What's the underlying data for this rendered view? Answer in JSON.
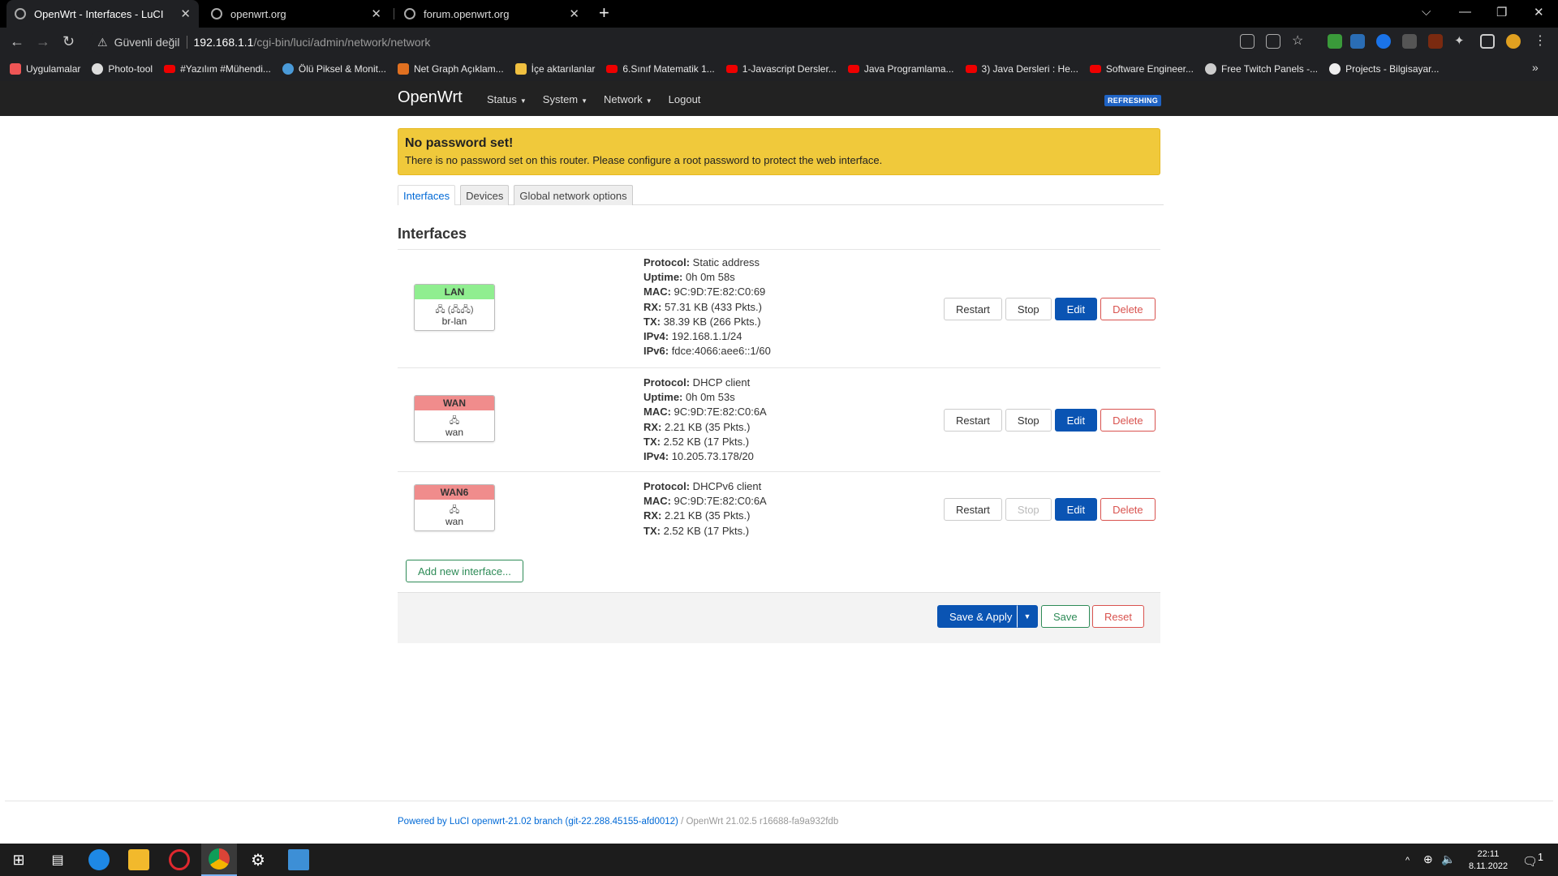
{
  "browser": {
    "tabs": [
      {
        "title": "OpenWrt - Interfaces - LuCI",
        "active": true
      },
      {
        "title": "openwrt.org",
        "active": false
      },
      {
        "title": "forum.openwrt.org",
        "active": false
      }
    ],
    "new_tab": "+",
    "security_label": "Güvenli değil",
    "url_host": "192.168.1.1",
    "url_path": "/cgi-bin/luci/admin/network/network",
    "bookmarks": [
      "Uygulamalar",
      "Photo-tool",
      "#Yazılım #Mühendi...",
      "Ölü Piksel & Monit...",
      "Net Graph Açıklam...",
      "İçe aktarılanlar",
      "6.Sınıf Matematik 1...",
      "1-Javascript Dersler...",
      "Java Programlama...",
      "3) Java Dersleri : He...",
      "Software Engineer...",
      "Free Twitch Panels -...",
      "Projects - Bilgisayar..."
    ],
    "bookmarks_more": "»"
  },
  "luci": {
    "brand": "OpenWrt",
    "menu": [
      "Status",
      "System",
      "Network",
      "Logout"
    ],
    "refresh_badge": "REFRESHING",
    "alert_title": "No password set!",
    "alert_text": "There is no password set on this router. Please configure a root password to protect the web interface.",
    "tabs": [
      "Interfaces",
      "Devices",
      "Global network options"
    ],
    "section_title": "Interfaces",
    "interfaces": [
      {
        "name": "LAN",
        "header_color": "#90ee90",
        "device": "br-lan",
        "icon_text": "🖧 (🖧🖧)",
        "details": [
          [
            "Protocol:",
            " Static address"
          ],
          [
            "Uptime:",
            " 0h 0m 58s"
          ],
          [
            "MAC:",
            " 9C:9D:7E:82:C0:69"
          ],
          [
            "RX:",
            " 57.31 KB (433 Pkts.)"
          ],
          [
            "TX:",
            " 38.39 KB (266 Pkts.)"
          ],
          [
            "IPv4:",
            " 192.168.1.1/24"
          ],
          [
            "IPv6:",
            " fdce:4066:aee6::1/60"
          ]
        ],
        "stop_disabled": false
      },
      {
        "name": "WAN",
        "header_color": "#f08c8c",
        "device": "wan",
        "icon_text": "🖧",
        "details": [
          [
            "Protocol:",
            " DHCP client"
          ],
          [
            "Uptime:",
            " 0h 0m 53s"
          ],
          [
            "MAC:",
            " 9C:9D:7E:82:C0:6A"
          ],
          [
            "RX:",
            " 2.21 KB (35 Pkts.)"
          ],
          [
            "TX:",
            " 2.52 KB (17 Pkts.)"
          ],
          [
            "IPv4:",
            " 10.205.73.178/20"
          ]
        ],
        "stop_disabled": false
      },
      {
        "name": "WAN6",
        "header_color": "#f08c8c",
        "device": "wan",
        "icon_text": "🖧",
        "details": [
          [
            "Protocol:",
            " DHCPv6 client"
          ],
          [
            "MAC:",
            " 9C:9D:7E:82:C0:6A"
          ],
          [
            "RX:",
            " 2.21 KB (35 Pkts.)"
          ],
          [
            "TX:",
            " 2.52 KB (17 Pkts.)"
          ]
        ],
        "stop_disabled": true
      }
    ],
    "buttons": {
      "restart": "Restart",
      "stop": "Stop",
      "edit": "Edit",
      "delete": "Delete"
    },
    "add_interface": "Add new interface...",
    "save_apply": "Save & Apply",
    "save": "Save",
    "reset": "Reset",
    "footer_link": "Powered by LuCI openwrt-21.02 branch (git-22.288.45155-afd0012)",
    "footer_version": " / OpenWrt 21.02.5 r16688-fa9a932fdb"
  },
  "taskbar": {
    "time": "22:11",
    "date": "8.11.2022",
    "notification_count": "1"
  }
}
